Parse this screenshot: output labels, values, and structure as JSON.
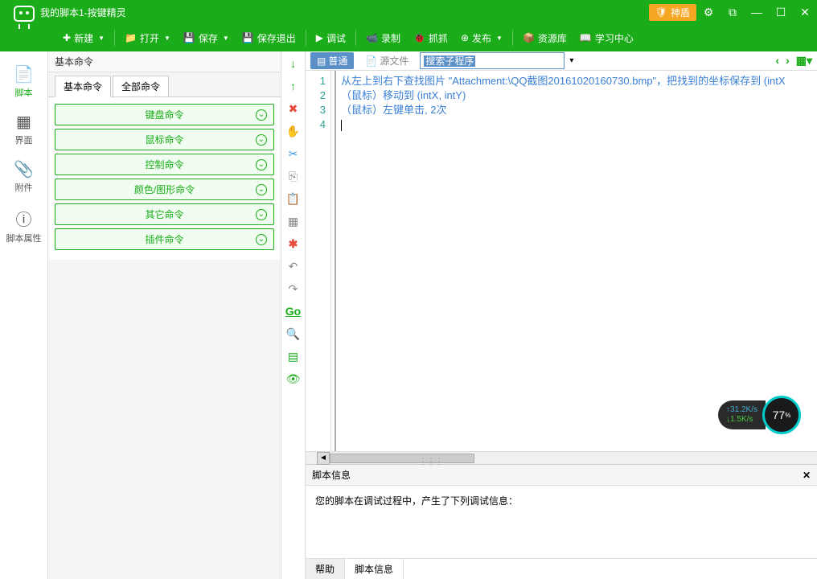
{
  "title": "我的脚本1-按键精灵",
  "shield": "神盾",
  "menu": {
    "new": "新建",
    "open": "打开",
    "save": "保存",
    "saveexit": "保存退出",
    "debug": "调试",
    "record": "录制",
    "grab": "抓抓",
    "publish": "发布",
    "resources": "资源库",
    "learn": "学习中心"
  },
  "leftbar": {
    "script": "脚本",
    "ui": "界面",
    "attach": "附件",
    "props": "脚本属性"
  },
  "cmdpanel": {
    "title": "基本命令",
    "tabs": [
      "基本命令",
      "全部命令"
    ],
    "cats": [
      "键盘命令",
      "鼠标命令",
      "控制命令",
      "颜色/图形命令",
      "其它命令",
      "插件命令"
    ]
  },
  "ebar": {
    "normal": "普通",
    "source": "源文件",
    "search": "搜索子程序"
  },
  "code": {
    "lines": [
      "从左上到右下查找图片 \"Attachment:\\QQ截图20161020160730.bmp\"，把找到的坐标保存到 (intX",
      "（鼠标）移动到 (intX, intY)",
      "（鼠标）左键单击, 2次",
      ""
    ]
  },
  "info": {
    "title": "脚本信息",
    "body": "您的脚本在调试过程中，产生了下列调试信息：",
    "tabs": [
      "帮助",
      "脚本信息"
    ]
  },
  "widget": {
    "up": "31.2K/s",
    "down": "1.5K/s",
    "pct": "77",
    "pctsym": "%"
  }
}
